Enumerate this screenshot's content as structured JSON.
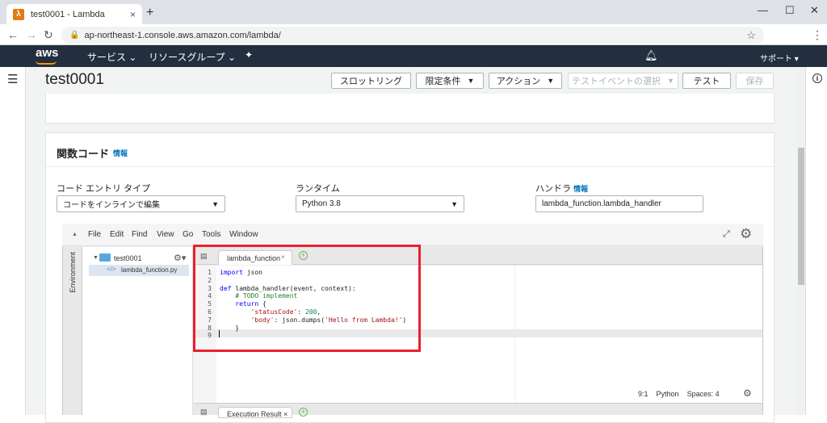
{
  "browser": {
    "tab_title": "test0001 - Lambda",
    "tab_close": "×",
    "new_tab": "+",
    "url": "ap-northeast-1.console.aws.amazon.com/lambda/",
    "win_min": "—",
    "win_max": "☐",
    "win_close": "✕"
  },
  "aws_nav": {
    "logo": "aws",
    "services": "サービス ⌄",
    "resource_groups": "リソースグループ ⌄",
    "support": "サポート ▾"
  },
  "header": {
    "function_name": "test0001",
    "buttons": {
      "throttle": "スロットリング",
      "qualifiers": "限定条件",
      "actions": "アクション",
      "test_event": "テストイベントの選択",
      "test": "テスト",
      "save": "保存"
    }
  },
  "function_code": {
    "title": "関数コード",
    "info": "情報",
    "code_entry_label": "コード エントリ タイプ",
    "code_entry_value": "コードをインラインで編集",
    "runtime_label": "ランタイム",
    "runtime_value": "Python 3.8",
    "handler_label": "ハンドラ",
    "handler_info": "情報",
    "handler_value": "lambda_function.lambda_handler"
  },
  "ide": {
    "menu": [
      "File",
      "Edit",
      "Find",
      "View",
      "Go",
      "Tools",
      "Window"
    ],
    "environment_label": "Environment",
    "tree_root": "test0001",
    "tree_file": "lambda_function.py",
    "editor_tab": "lambda_function",
    "exec_tab": "Execution Result",
    "line_numbers": [
      "1",
      "2",
      "3",
      "4",
      "5",
      "6",
      "7",
      "8",
      "9"
    ],
    "status": {
      "position": "9:1",
      "language": "Python",
      "spaces": "Spaces: 4"
    }
  },
  "code_lines": [
    "import json",
    "",
    "def lambda_handler(event, context):",
    "    # TODO implement",
    "    return {",
    "        'statusCode': 200,",
    "        'body': json.dumps('Hello from Lambda!')",
    "    }",
    ""
  ],
  "colors": {
    "aws_nav_bg": "#232f3e",
    "aws_orange": "#ff9900",
    "highlight": "#e8212d",
    "info_link": "#0073bb"
  }
}
